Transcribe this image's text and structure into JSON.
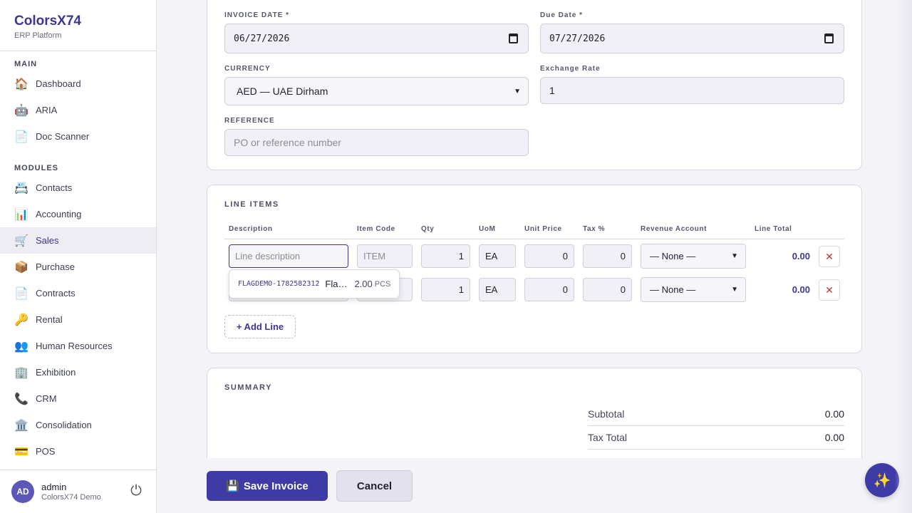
{
  "brand": {
    "title": "ColorsX74",
    "subtitle": "ERP Platform"
  },
  "sidebar": {
    "main_heading": "MAIN",
    "modules_heading": "MODULES",
    "main_items": [
      {
        "label": "Dashboard",
        "icon": "🏠"
      },
      {
        "label": "ARIA",
        "icon": "🤖"
      },
      {
        "label": "Doc Scanner",
        "icon": "📄"
      }
    ],
    "module_items": [
      {
        "label": "Contacts",
        "icon": "📇"
      },
      {
        "label": "Accounting",
        "icon": "📊"
      },
      {
        "label": "Sales",
        "icon": "🛒",
        "active": true
      },
      {
        "label": "Purchase",
        "icon": "📦"
      },
      {
        "label": "Contracts",
        "icon": "📄"
      },
      {
        "label": "Rental",
        "icon": "🔑"
      },
      {
        "label": "Human Resources",
        "icon": "👥"
      },
      {
        "label": "Exhibition",
        "icon": "🏢"
      },
      {
        "label": "CRM",
        "icon": "📞"
      },
      {
        "label": "Consolidation",
        "icon": "🏛️"
      },
      {
        "label": "POS",
        "icon": "💳"
      }
    ]
  },
  "user": {
    "initials": "AD",
    "name": "admin",
    "org": "ColorsX74 Demo",
    "logout_icon": "⏻"
  },
  "form": {
    "invoice_date_label": "INVOICE DATE *",
    "invoice_date_value": "06/27/2026",
    "due_date_label": "Due Date *",
    "due_date_value": "07/27/2026",
    "currency_label": "CURRENCY",
    "currency_value": "AED — UAE Dirham",
    "exchange_rate_label": "Exchange Rate",
    "exchange_rate_value": "1",
    "reference_label": "REFERENCE",
    "reference_placeholder": "PO or reference number"
  },
  "line_items": {
    "title": "LINE ITEMS",
    "headers": [
      "Description",
      "Item Code",
      "Qty",
      "UoM",
      "Unit Price",
      "Tax %",
      "Revenue Account",
      "Line Total"
    ],
    "description_placeholder": "Line description",
    "item_code_placeholder": "ITEM",
    "rows": [
      {
        "qty": "1",
        "uom": "EA",
        "unit_price": "0",
        "tax": "0",
        "account": "— None —",
        "total": "0.00"
      },
      {
        "qty": "1",
        "uom": "EA",
        "unit_price": "0",
        "tax": "0",
        "account": "— None —",
        "total": "0.00"
      }
    ],
    "delete_symbol": "✕",
    "add_line_label": "+ Add Line",
    "suggestion": {
      "code": "FLAGDEMO-1782582312",
      "name": "Fla…",
      "qty": "2.00",
      "uom": "PCS"
    }
  },
  "summary": {
    "title": "SUMMARY",
    "subtotal_label": "Subtotal",
    "subtotal_value": "0.00",
    "tax_total_label": "Tax Total",
    "tax_total_value": "0.00"
  },
  "actions": {
    "save_label": "Save Invoice",
    "save_icon": "💾",
    "cancel_label": "Cancel"
  },
  "fab_icon": "✨"
}
